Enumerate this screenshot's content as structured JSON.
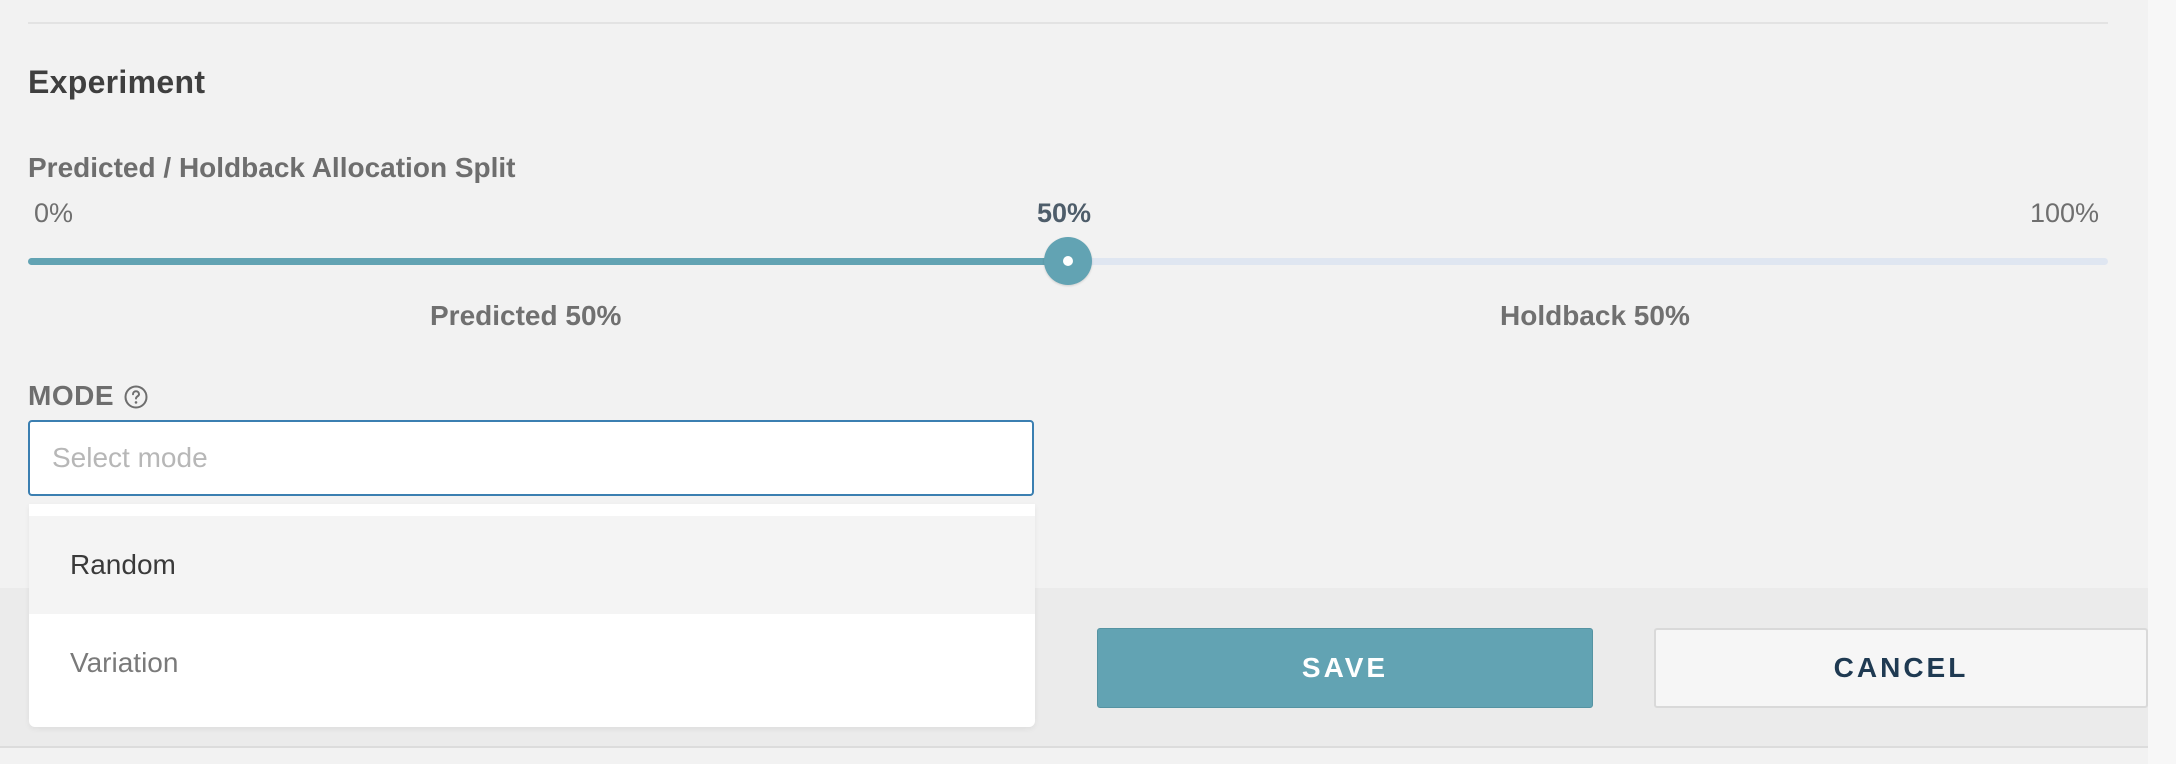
{
  "section": {
    "title": "Experiment"
  },
  "allocation": {
    "label": "Predicted / Holdback Allocation Split",
    "min_label": "0%",
    "max_label": "100%",
    "value_label": "50%",
    "value_fraction": 0.5,
    "predicted_label": "Predicted 50%",
    "holdback_label": "Holdback 50%"
  },
  "mode": {
    "label": "MODE",
    "help_icon": "question-circle-icon",
    "placeholder": "Select mode",
    "value": "",
    "options": [
      {
        "label": "Random",
        "highlighted": true
      },
      {
        "label": "Variation",
        "highlighted": false
      }
    ]
  },
  "actions": {
    "save_label": "SAVE",
    "cancel_label": "CANCEL"
  },
  "colors": {
    "accent": "#62a3b3",
    "track": "#dfe6f1",
    "input_border": "#3b7fb1",
    "cancel_text": "#1f3a52"
  }
}
